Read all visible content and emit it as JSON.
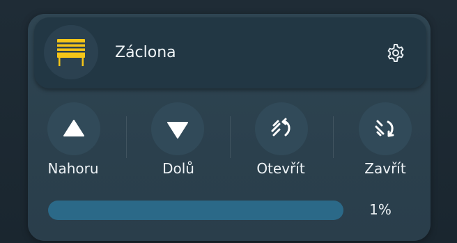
{
  "device": {
    "name": "Záclona",
    "icon": "blinds-icon",
    "accent_color": "#f5c518"
  },
  "settings": {
    "icon": "gear-icon"
  },
  "controls": [
    {
      "id": "up",
      "label": "Nahoru",
      "icon": "triangle-up-icon"
    },
    {
      "id": "down",
      "label": "Dolů",
      "icon": "triangle-down-icon"
    },
    {
      "id": "open",
      "label": "Otevřít",
      "icon": "tilt-open-icon"
    },
    {
      "id": "close",
      "label": "Zavřít",
      "icon": "tilt-close-icon"
    }
  ],
  "position": {
    "value_text": "1%",
    "value": 0.01,
    "track_color": "#2b6988"
  }
}
